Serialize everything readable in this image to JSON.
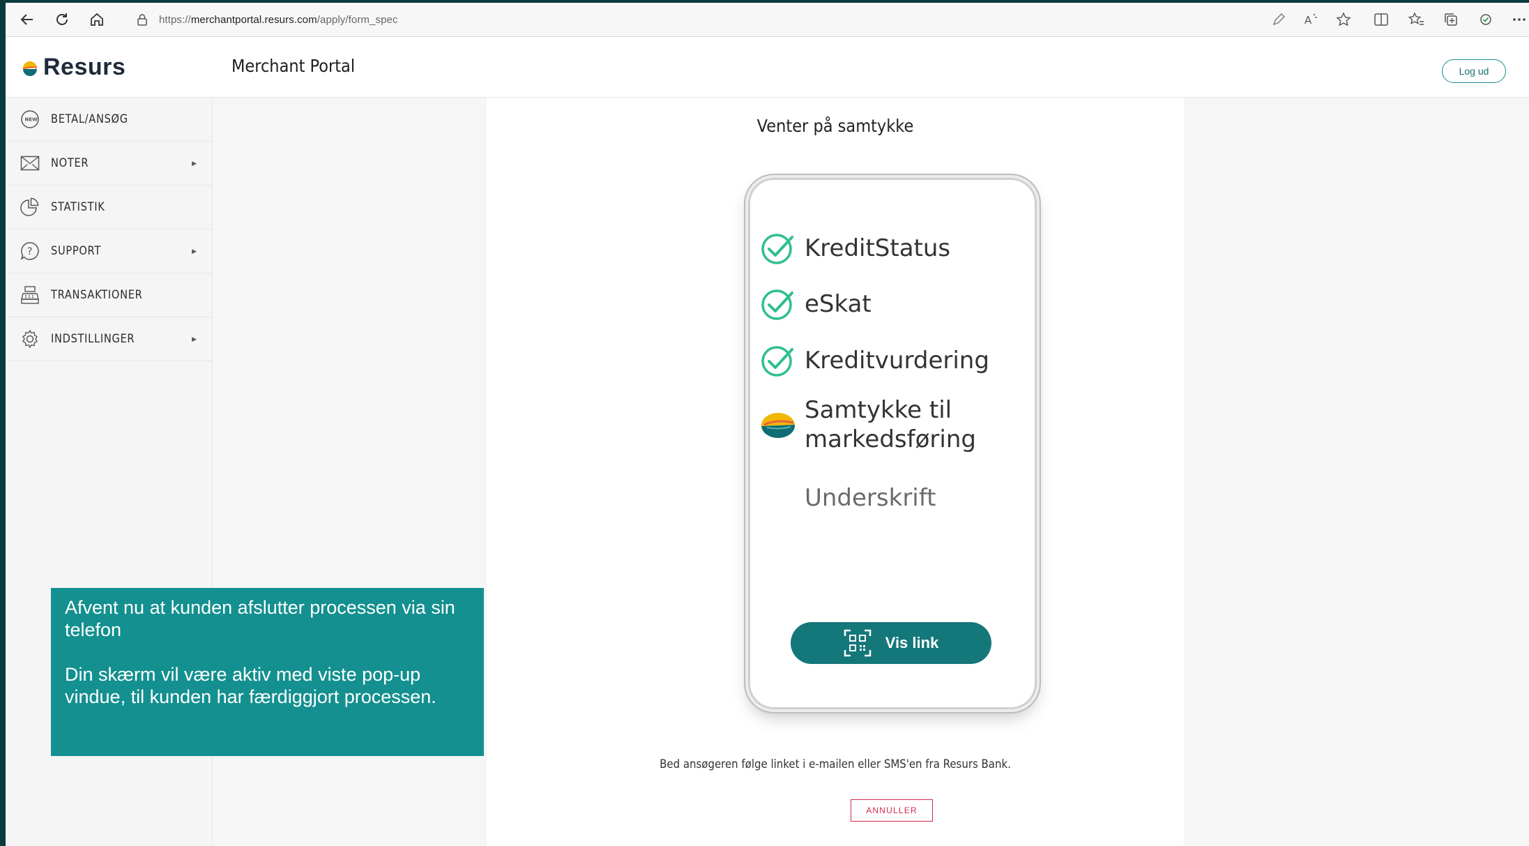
{
  "browser": {
    "url_prefix": "https://",
    "url_host": "merchantportal.resurs.com",
    "url_path": "/apply/form_spec"
  },
  "header": {
    "logo_text": "Resurs",
    "portal_title": "Merchant Portal",
    "logout_label": "Log ud"
  },
  "sidebar": {
    "items": [
      {
        "label": "BETAL/ANSØG",
        "icon": "new-badge-icon",
        "has_arrow": false
      },
      {
        "label": "NOTER",
        "icon": "envelope-icon",
        "has_arrow": true
      },
      {
        "label": "STATISTIK",
        "icon": "pie-chart-icon",
        "has_arrow": false
      },
      {
        "label": "SUPPORT",
        "icon": "question-icon",
        "has_arrow": true
      },
      {
        "label": "TRANSAKTIONER",
        "icon": "register-icon",
        "has_arrow": false
      },
      {
        "label": "INDSTILLINGER",
        "icon": "gear-icon",
        "has_arrow": true
      }
    ]
  },
  "main": {
    "title": "Venter på samtykke",
    "steps": [
      {
        "label": "KreditStatus",
        "status": "done"
      },
      {
        "label": "eSkat",
        "status": "done"
      },
      {
        "label": "Kreditvurdering",
        "status": "done"
      },
      {
        "label": "Samtykke til markedsføring",
        "status": "in-progress"
      },
      {
        "label": "Underskrift",
        "status": "pending"
      }
    ],
    "vis_link_label": "Vis link",
    "instruction": "Bed ansøgeren følge linket i e-mailen eller SMS'en fra Resurs Bank.",
    "cancel_label": "ANNULLER"
  },
  "callout": {
    "line1": "Afvent nu at kunden afslutter processen via sin telefon",
    "line2": "Din skærm vil være aktiv med viste pop-up vindue, til kunden har færdiggjort processen."
  },
  "colors": {
    "teal": "#14777a",
    "callout": "#13908f",
    "check_green": "#2fbf8f",
    "cancel_red": "#d12a4d"
  }
}
